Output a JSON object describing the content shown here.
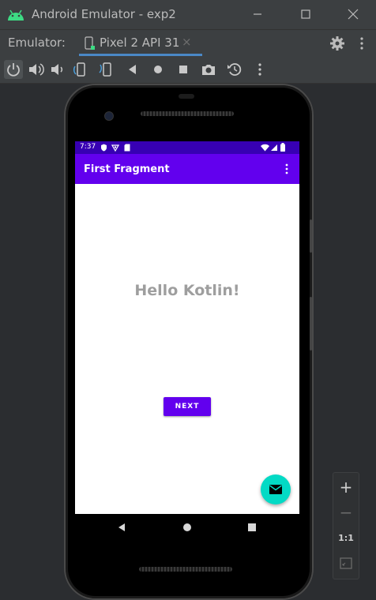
{
  "window": {
    "title": "Android Emulator - exp2",
    "minimize_icon": "minimize-icon",
    "maximize_icon": "maximize-icon",
    "close_icon": "close-icon"
  },
  "tabbar": {
    "emulator_label": "Emulator:",
    "tab_label": "Pixel 2 API 31",
    "tab_close": "×",
    "settings_icon": "gear-icon",
    "more_icon": "more-vertical-icon"
  },
  "toolbar": {
    "tools": [
      "power-icon",
      "volume-up-icon",
      "volume-down-icon",
      "rotate-left-icon",
      "rotate-right-icon",
      "back-icon",
      "home-icon",
      "overview-icon",
      "camera-icon",
      "snapshot-icon",
      "more-vertical-icon"
    ]
  },
  "phone": {
    "status_bar": {
      "time": "7:37"
    },
    "app_bar": {
      "title": "First Fragment"
    },
    "content": {
      "message": "Hello Kotlin!",
      "next_button": "NEXT"
    },
    "fab_icon": "email-icon"
  },
  "zoom_panel": {
    "zoom_in": "+",
    "zoom_out": "−",
    "one_to_one": "1:1",
    "fit_icon": "fit-screen-icon"
  },
  "colors": {
    "status_bar": "#3700b3",
    "app_bar": "#6200ee",
    "fab": "#03dac5",
    "ide_background": "#2b2d30",
    "tab_underline": "#4a88c7"
  }
}
